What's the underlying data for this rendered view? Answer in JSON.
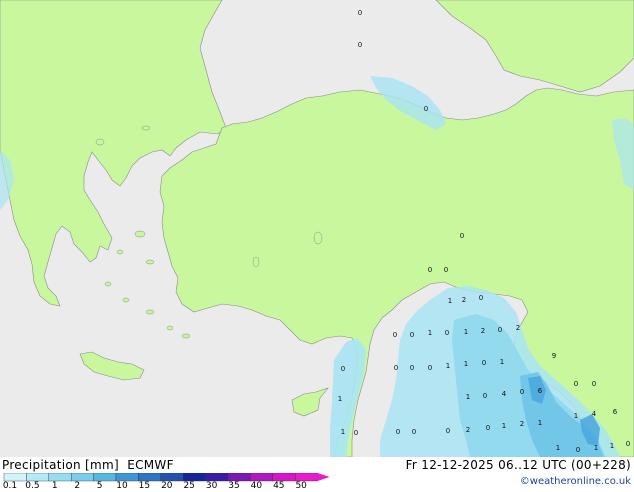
{
  "header": {
    "title_left": "Precipitation [mm]  ECMWF",
    "title_right": "Fr 12-12-2025 06..12 UTC (00+228)"
  },
  "credit": "©weatheronline.co.uk",
  "colors": {
    "sea": "#ebebeb",
    "land": "#c9f79e",
    "coast": "#8a8a8a",
    "precip_01": "#c8f0f8",
    "precip_05": "#a9e4f4",
    "precip_1": "#8fd8ee",
    "precip_2": "#6fc4e8",
    "precip_5": "#4aa6dc"
  },
  "legend": {
    "ticks": [
      "0.1",
      "0.5",
      "1",
      "2",
      "5",
      "10",
      "15",
      "20",
      "25",
      "30",
      "35",
      "40",
      "45",
      "50"
    ],
    "colors": [
      "#d2f3fa",
      "#b4e9f6",
      "#96dcf2",
      "#78cdec",
      "#55b6e2",
      "#3e96d4",
      "#2f74c4",
      "#2450b0",
      "#15259a",
      "#3a1aa8",
      "#7a18b8",
      "#b018c2",
      "#d418c8",
      "#e81ccc"
    ]
  },
  "map_numbers": [
    {
      "t": "0"
    },
    {
      "t": "0"
    },
    {
      "t": "0"
    },
    {
      "t": "0"
    },
    {
      "t": "0"
    },
    {
      "t": "0"
    },
    {
      "t": "0"
    },
    {
      "t": "1"
    },
    {
      "t": "2"
    },
    {
      "t": "0"
    },
    {
      "t": "0"
    },
    {
      "t": "0"
    },
    {
      "t": "1"
    },
    {
      "t": "0"
    },
    {
      "t": "1"
    },
    {
      "t": "2"
    },
    {
      "t": "0"
    },
    {
      "t": "2"
    },
    {
      "t": "0"
    },
    {
      "t": "0"
    },
    {
      "t": "0"
    },
    {
      "t": "1"
    },
    {
      "t": "1"
    },
    {
      "t": "0"
    },
    {
      "t": "1"
    },
    {
      "t": "0"
    },
    {
      "t": "0"
    },
    {
      "t": "9"
    },
    {
      "t": "1"
    },
    {
      "t": "1"
    },
    {
      "t": "0"
    },
    {
      "t": "4"
    },
    {
      "t": "0"
    },
    {
      "t": "6"
    },
    {
      "t": "1"
    },
    {
      "t": "0"
    },
    {
      "t": "0"
    },
    {
      "t": "0"
    },
    {
      "t": "0"
    },
    {
      "t": "2"
    },
    {
      "t": "0"
    },
    {
      "t": "1"
    },
    {
      "t": "2"
    },
    {
      "t": "1"
    },
    {
      "t": "1"
    },
    {
      "t": "4"
    },
    {
      "t": "6"
    },
    {
      "t": "1"
    },
    {
      "t": "0"
    },
    {
      "t": "1"
    },
    {
      "t": "1"
    },
    {
      "t": "0"
    }
  ]
}
